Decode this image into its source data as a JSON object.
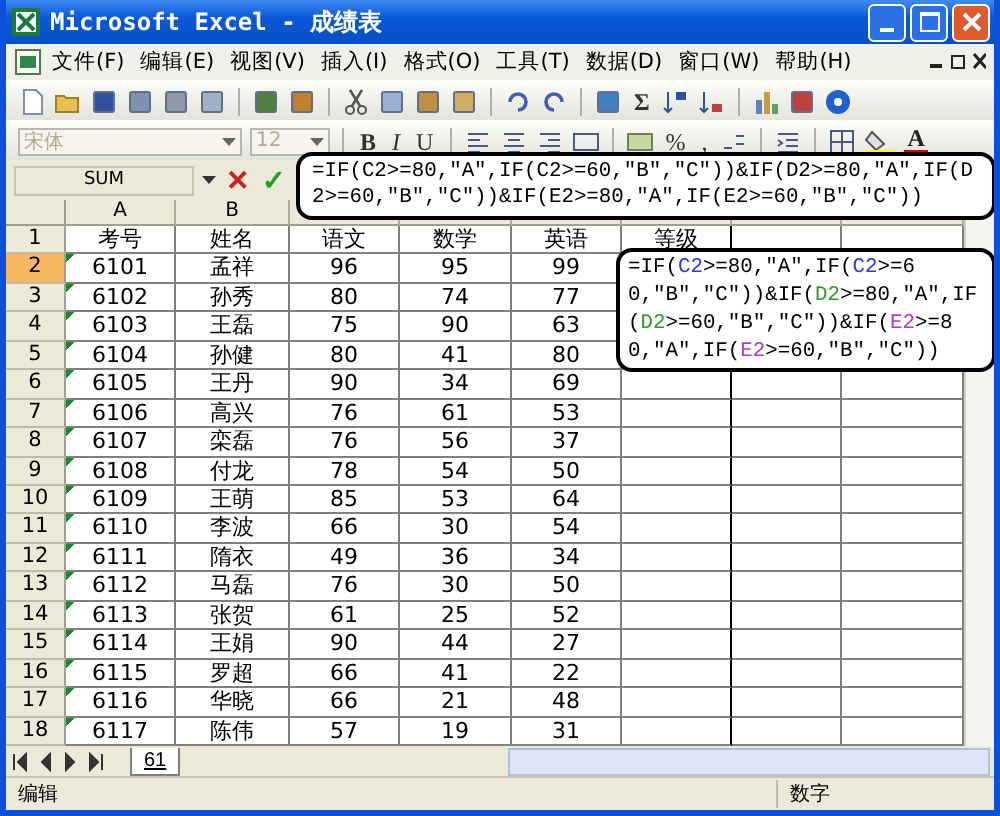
{
  "window": {
    "title": "Microsoft Excel - 成绩表"
  },
  "menu": [
    "文件(F)",
    "编辑(E)",
    "视图(V)",
    "插入(I)",
    "格式(O)",
    "工具(T)",
    "数据(D)",
    "窗口(W)",
    "帮助(H)"
  ],
  "toolbar": {
    "sum_glyph": "Σ",
    "font": "宋体",
    "size": "12",
    "bold": "B",
    "italic": "I",
    "underline": "U",
    "percent": "%",
    "comma": ",",
    "font_color": "A"
  },
  "formula_bar": {
    "name_box": "SUM",
    "cancel": "✕",
    "enter": "✓",
    "formula": "=IF(C2>=80,\"A\",IF(C2>=60,\"B\",\"C\"))&IF(D2>=80,\"A\",IF(D2>=60,\"B\",\"C\"))&IF(E2>=80,\"A\",IF(E2>=60,\"B\",\"C\"))"
  },
  "columns": [
    "A",
    "B"
  ],
  "rows": [
    {
      "number": "1",
      "selected": false,
      "flagged": false,
      "cells": [
        "考号",
        "姓名",
        "语文",
        "数学",
        "英语",
        "等级"
      ]
    },
    {
      "number": "2",
      "selected": true,
      "flagged": true,
      "cells": [
        "6101",
        "孟祥",
        "96",
        "95",
        "99"
      ]
    },
    {
      "number": "3",
      "selected": false,
      "flagged": true,
      "cells": [
        "6102",
        "孙秀",
        "80",
        "74",
        "77"
      ]
    },
    {
      "number": "4",
      "selected": false,
      "flagged": true,
      "cells": [
        "6103",
        "王磊",
        "75",
        "90",
        "63"
      ]
    },
    {
      "number": "5",
      "selected": false,
      "flagged": true,
      "cells": [
        "6104",
        "孙健",
        "80",
        "41",
        "80"
      ]
    },
    {
      "number": "6",
      "selected": false,
      "flagged": true,
      "cells": [
        "6105",
        "王丹",
        "90",
        "34",
        "69"
      ]
    },
    {
      "number": "7",
      "selected": false,
      "flagged": true,
      "cells": [
        "6106",
        "高兴",
        "76",
        "61",
        "53"
      ]
    },
    {
      "number": "8",
      "selected": false,
      "flagged": true,
      "cells": [
        "6107",
        "栾磊",
        "76",
        "56",
        "37"
      ]
    },
    {
      "number": "9",
      "selected": false,
      "flagged": true,
      "cells": [
        "6108",
        "付龙",
        "78",
        "54",
        "50"
      ]
    },
    {
      "number": "10",
      "selected": false,
      "flagged": true,
      "cells": [
        "6109",
        "王萌",
        "85",
        "53",
        "64"
      ]
    },
    {
      "number": "11",
      "selected": false,
      "flagged": true,
      "cells": [
        "6110",
        "李波",
        "66",
        "30",
        "54"
      ]
    },
    {
      "number": "12",
      "selected": false,
      "flagged": true,
      "cells": [
        "6111",
        "隋衣",
        "49",
        "36",
        "34"
      ]
    },
    {
      "number": "13",
      "selected": false,
      "flagged": true,
      "cells": [
        "6112",
        "马磊",
        "76",
        "30",
        "50"
      ]
    },
    {
      "number": "14",
      "selected": false,
      "flagged": true,
      "cells": [
        "6113",
        "张贺",
        "61",
        "25",
        "52"
      ]
    },
    {
      "number": "15",
      "selected": false,
      "flagged": true,
      "cells": [
        "6114",
        "王娟",
        "90",
        "44",
        "27"
      ]
    },
    {
      "number": "16",
      "selected": false,
      "flagged": true,
      "cells": [
        "6115",
        "罗超",
        "66",
        "41",
        "22"
      ]
    },
    {
      "number": "17",
      "selected": false,
      "flagged": true,
      "cells": [
        "6116",
        "华晓",
        "66",
        "21",
        "48"
      ]
    },
    {
      "number": "18",
      "selected": false,
      "flagged": true,
      "cells": [
        "6117",
        "陈伟",
        "57",
        "19",
        "31"
      ]
    }
  ],
  "cell_editor": {
    "parts": [
      {
        "text": "=IF("
      },
      {
        "text": "C2",
        "color": "#3434e0"
      },
      {
        "text": ">=80,\"A\",IF("
      },
      {
        "text": "C2",
        "color": "#3434e0"
      },
      {
        "text": ">=60,\"B\",\"C\"))&IF("
      },
      {
        "text": "D2",
        "color": "#2e9a2e"
      },
      {
        "text": ">=80,\"A\",IF("
      },
      {
        "text": "D2",
        "color": "#2e9a2e"
      },
      {
        "text": ">=60,\"B\",\"C\"))&IF("
      },
      {
        "text": "E2",
        "color": "#a040c8"
      },
      {
        "text": ">=80,\"A\",IF("
      },
      {
        "text": "E2",
        "color": "#a040c8"
      },
      {
        "text": ">=60,\"B\",\"C\"))"
      }
    ]
  },
  "sheet_tabs": [
    {
      "label": "61",
      "selected": true
    }
  ],
  "status_bar": {
    "mode": "编辑",
    "indicator": "数字"
  }
}
